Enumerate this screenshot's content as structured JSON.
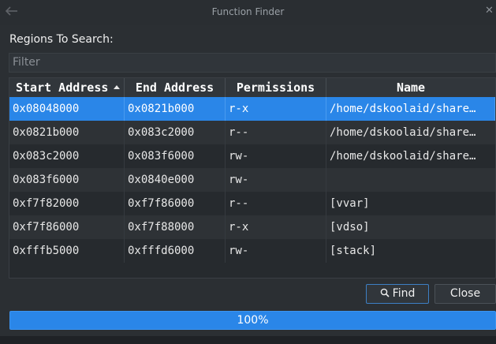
{
  "window": {
    "title": "Function Finder",
    "back_icon": "back-arrow-icon",
    "close_icon": "close-icon"
  },
  "regions_label": "Regions To Search:",
  "filter": {
    "placeholder": "Filter",
    "value": ""
  },
  "table": {
    "columns": [
      "Start Address",
      "End Address",
      "Permissions",
      "Name"
    ],
    "sort_column": "Start Address",
    "sort_order": "ascending",
    "rows": [
      {
        "start": "0x08048000",
        "end": "0x0821b000",
        "perm": "r-x",
        "name": "/home/dskoolaid/share…",
        "selected": true
      },
      {
        "start": "0x0821b000",
        "end": "0x083c2000",
        "perm": "r--",
        "name": "/home/dskoolaid/share…",
        "selected": false
      },
      {
        "start": "0x083c2000",
        "end": "0x083f6000",
        "perm": "rw-",
        "name": "/home/dskoolaid/share…",
        "selected": false
      },
      {
        "start": "0x083f6000",
        "end": "0x0840e000",
        "perm": "rw-",
        "name": "",
        "selected": false
      },
      {
        "start": "0xf7f82000",
        "end": "0xf7f86000",
        "perm": "r--",
        "name": "[vvar]",
        "selected": false
      },
      {
        "start": "0xf7f86000",
        "end": "0xf7f88000",
        "perm": "r-x",
        "name": "[vdso]",
        "selected": false
      },
      {
        "start": "0xfffb5000",
        "end": "0xfffd6000",
        "perm": "rw-",
        "name": "[stack]",
        "selected": false
      }
    ]
  },
  "buttons": {
    "find": "Find",
    "close": "Close"
  },
  "progress": {
    "value": 1.0,
    "label": "100%"
  },
  "colors": {
    "accent": "#2a86e8",
    "background": "#2b2f33"
  }
}
